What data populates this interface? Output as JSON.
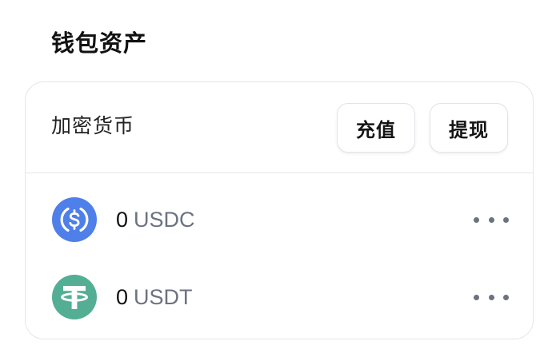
{
  "wallet": {
    "title": "钱包资产"
  },
  "card": {
    "title": "加密货币",
    "deposit_label": "充值",
    "withdraw_label": "提现"
  },
  "assets": [
    {
      "amount": "0",
      "symbol": "USDC",
      "icon": "usdc-coin-icon",
      "icon_color": "#4f7fe8"
    },
    {
      "amount": "0",
      "symbol": "USDT",
      "icon": "usdt-coin-icon",
      "icon_color": "#53ae94"
    }
  ]
}
